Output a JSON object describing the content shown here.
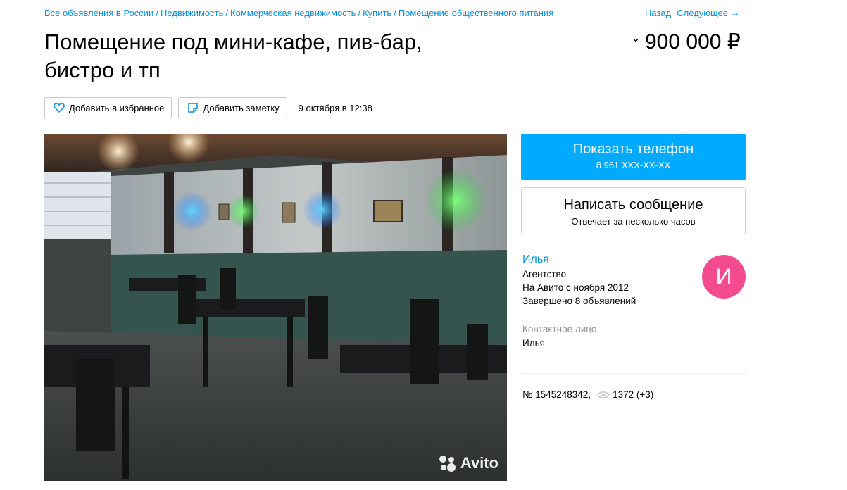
{
  "breadcrumbs": [
    "Все объявления в России",
    "Недвижимость",
    "Коммерческая недвижимость",
    "Купить",
    "Помещение общественного питания"
  ],
  "breadcrumb_separator": "/",
  "nav": {
    "back": "Назад",
    "next": "Следующее →"
  },
  "title_line1": "Помещение под мини-кафе, пив-бар,",
  "title_line2": "бистро и тп",
  "price": "900 000 ₽",
  "actions": {
    "favorite": "Добавить в избранное",
    "note": "Добавить заметку",
    "date": "9 октября в 12:38"
  },
  "gallery": {
    "watermark": "Avito"
  },
  "phone_button": {
    "label": "Показать телефон",
    "number": "8 961 XXX-XX-XX"
  },
  "message_button": {
    "label": "Написать сообщение",
    "sub": "Отвечает за несколько часов"
  },
  "seller": {
    "name": "Илья",
    "type": "Агентство",
    "since": "На Авито с ноября 2012",
    "completed": "Завершено 8 объявлений",
    "avatar_letter": "И",
    "contact_label": "Контактное лицо",
    "contact_name": "Илья"
  },
  "listing": {
    "number": "№ 1545248342,",
    "views": "1372 (+3)"
  },
  "colors": {
    "link": "#0091d9",
    "primary_button": "#00aaff",
    "avatar": "#f44a8f"
  },
  "icons": [
    "heart-icon",
    "note-icon",
    "chevron-down-icon",
    "eye-icon",
    "avito-logo-icon"
  ]
}
